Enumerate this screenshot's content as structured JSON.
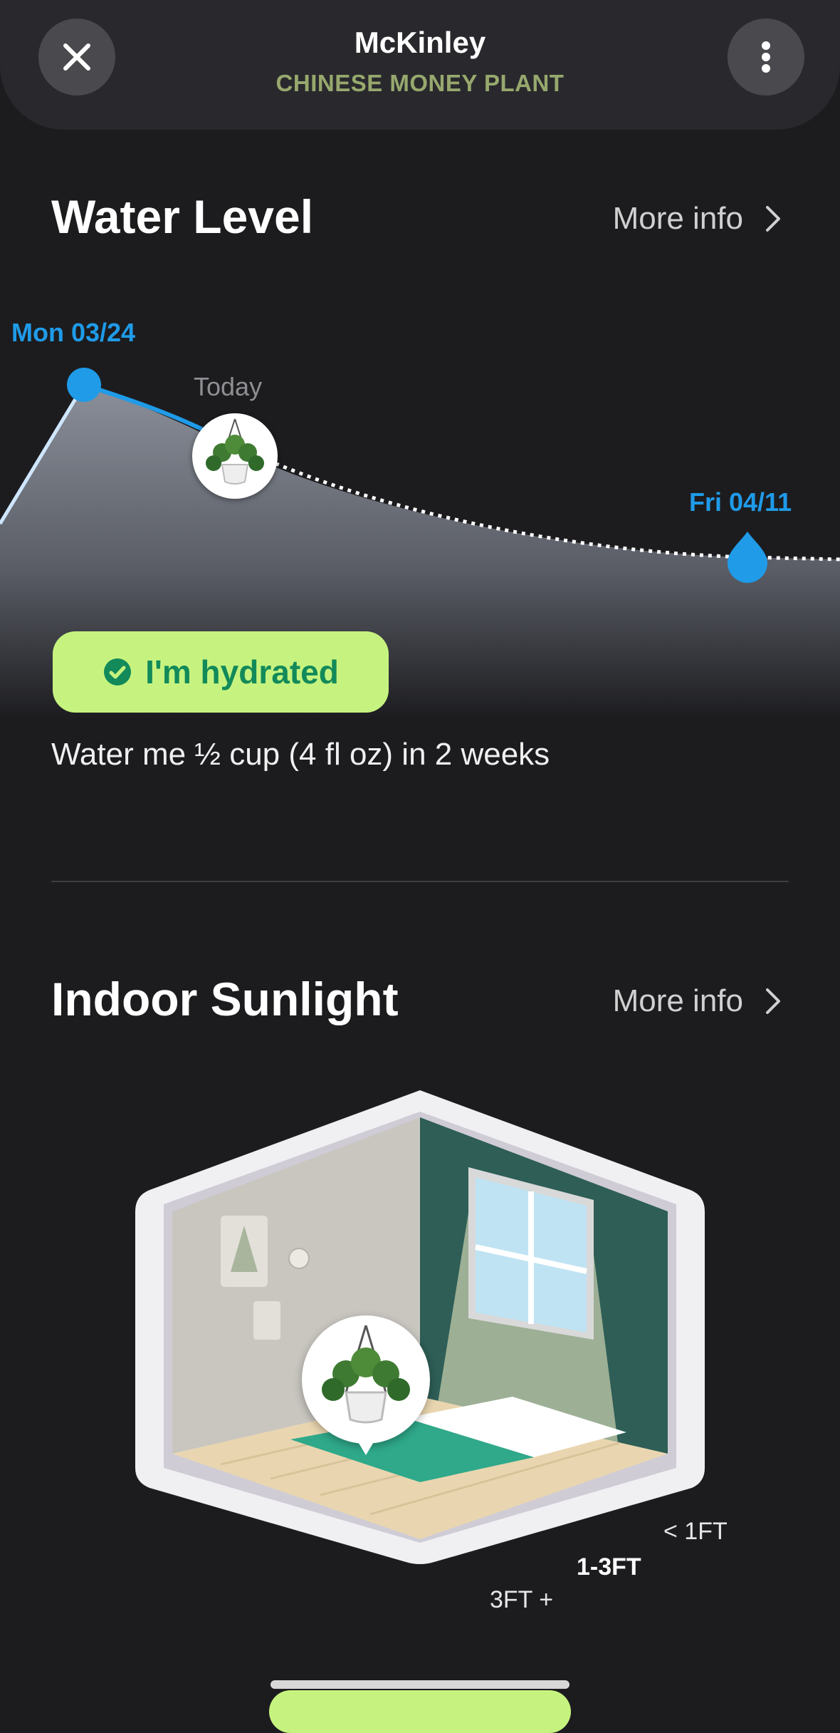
{
  "header": {
    "plant_name": "McKinley",
    "plant_species": "CHINESE MONEY PLANT",
    "close_icon": "close-icon",
    "more_icon": "more-vertical-icon"
  },
  "water_level": {
    "title": "Water Level",
    "more_info": "More info",
    "start_label": "Mon 03/24",
    "today_label": "Today",
    "end_label": "Fri 04/11",
    "badge": "I'm hydrated",
    "note": "Water me ½ cup (4 fl oz) in 2 weeks"
  },
  "indoor_sunlight": {
    "title": "Indoor Sunlight",
    "more_info": "More info",
    "distance_labels": [
      "< 1FT",
      "1-3FT",
      "3FT +"
    ],
    "selected_distance": "1-3FT"
  },
  "colors": {
    "accent_blue": "#1f9be8",
    "badge_bg": "#c6f37f",
    "badge_text": "#128a5a",
    "species_text": "#97a86d"
  }
}
